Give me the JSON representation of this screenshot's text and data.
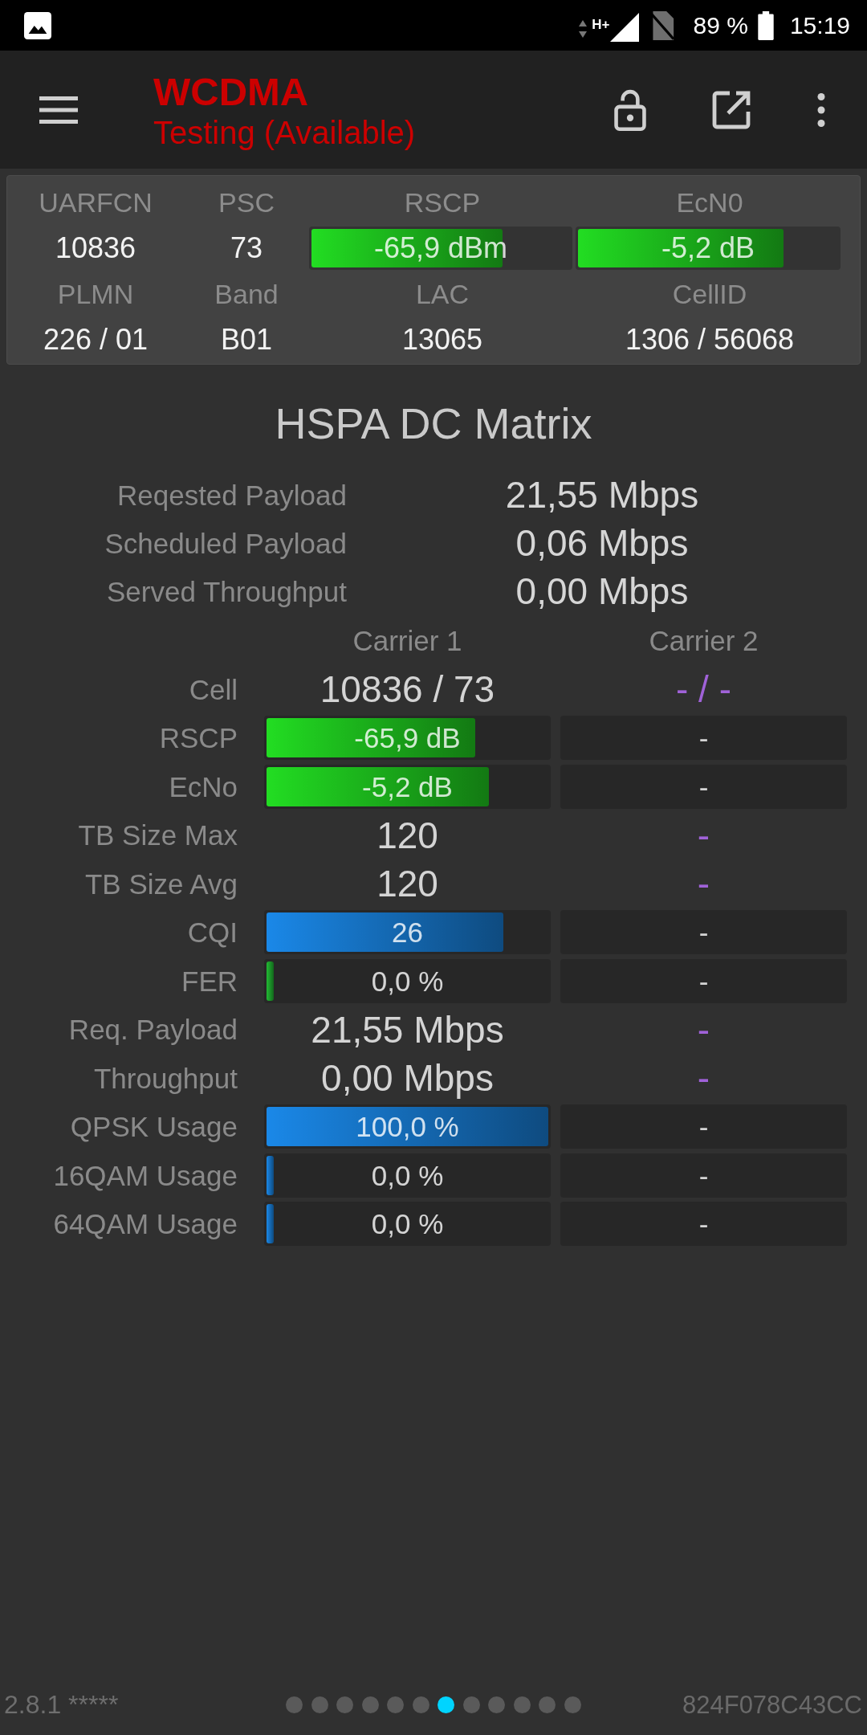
{
  "status_bar": {
    "network": "H+",
    "battery": "89 %",
    "time": "15:19"
  },
  "app_bar": {
    "title": "WCDMA",
    "subtitle": "Testing (Available)"
  },
  "cell_info": {
    "fields": [
      {
        "label": "UARFCN",
        "kind": "text",
        "value": "10836"
      },
      {
        "label": "PSC",
        "kind": "text",
        "value": "73"
      },
      {
        "label": "RSCP",
        "kind": "bar",
        "value": "-65,9 dBm",
        "level": 0.74,
        "color": "#22dd22"
      },
      {
        "label": "EcN0",
        "kind": "bar",
        "value": "-5,2 dB",
        "level": 0.79,
        "color": "#22dd22"
      },
      {
        "label": "PLMN",
        "kind": "text",
        "value": "226 / 01"
      },
      {
        "label": "Band",
        "kind": "text",
        "value": "B01"
      },
      {
        "label": "LAC",
        "kind": "text",
        "value": "13065"
      },
      {
        "label": "CellID",
        "kind": "text",
        "value": "1306 / 56068"
      }
    ]
  },
  "matrix": {
    "title": "HSPA DC Matrix",
    "summary": [
      {
        "label": "Reqested Payload",
        "value": "21,55 Mbps"
      },
      {
        "label": "Scheduled Payload",
        "value": "0,06 Mbps"
      },
      {
        "label": "Served Throughput",
        "value": "0,00 Mbps"
      }
    ],
    "columns": [
      "Carrier 1",
      "Carrier 2"
    ],
    "rows": [
      {
        "label": "Cell",
        "kind": "text",
        "carrier_1": {
          "text": "10836 / 73"
        },
        "carrier_2": {
          "text": "- / -"
        }
      },
      {
        "label": "RSCP",
        "kind": "bar",
        "carrier_1": {
          "text": "-65,9 dB",
          "level": 0.74,
          "color": "#22dd22"
        },
        "carrier_2": {
          "text": "-"
        }
      },
      {
        "label": "EcNo",
        "kind": "bar",
        "carrier_1": {
          "text": "-5,2 dB",
          "level": 0.79,
          "color": "#22dd22"
        },
        "carrier_2": {
          "text": "-"
        }
      },
      {
        "label": "TB Size Max",
        "kind": "text",
        "carrier_1": {
          "text": "120"
        },
        "carrier_2": {
          "text": "-"
        }
      },
      {
        "label": "TB Size Avg",
        "kind": "text",
        "carrier_1": {
          "text": "120"
        },
        "carrier_2": {
          "text": "-"
        }
      },
      {
        "label": "CQI",
        "kind": "bar",
        "carrier_1": {
          "text": "26",
          "level": 0.84,
          "color": "#1a88e8"
        },
        "carrier_2": {
          "text": "-"
        }
      },
      {
        "label": "FER",
        "kind": "bar",
        "carrier_1": {
          "text": "0,0 %",
          "level": 0.025,
          "color": "#22bb33"
        },
        "carrier_2": {
          "text": "-"
        }
      },
      {
        "label": "Req. Payload",
        "kind": "text",
        "carrier_1": {
          "text": "21,55 Mbps"
        },
        "carrier_2": {
          "text": "-"
        }
      },
      {
        "label": "Throughput",
        "kind": "text",
        "carrier_1": {
          "text": "0,00 Mbps"
        },
        "carrier_2": {
          "text": "-"
        }
      },
      {
        "label": "QPSK Usage",
        "kind": "bar",
        "carrier_1": {
          "text": "100,0 %",
          "level": 1,
          "color": "#1a88e8"
        },
        "carrier_2": {
          "text": "-"
        }
      },
      {
        "label": "16QAM Usage",
        "kind": "bar",
        "carrier_1": {
          "text": "0,0 %",
          "level": 0.025,
          "color": "#1a88e8"
        },
        "carrier_2": {
          "text": "-"
        }
      },
      {
        "label": "64QAM Usage",
        "kind": "bar",
        "carrier_1": {
          "text": "0,0 %",
          "level": 0.025,
          "color": "#1a88e8"
        },
        "carrier_2": {
          "text": "-"
        }
      }
    ]
  },
  "footer": {
    "version": "2.8.1 *****",
    "pages": [
      {
        "selected": false
      },
      {
        "selected": false
      },
      {
        "selected": false
      },
      {
        "selected": false
      },
      {
        "selected": false
      },
      {
        "selected": false
      },
      {
        "selected": true
      },
      {
        "selected": false
      },
      {
        "selected": false
      },
      {
        "selected": false
      },
      {
        "selected": false
      },
      {
        "selected": false
      }
    ],
    "device_id": "824F078C43CC"
  }
}
